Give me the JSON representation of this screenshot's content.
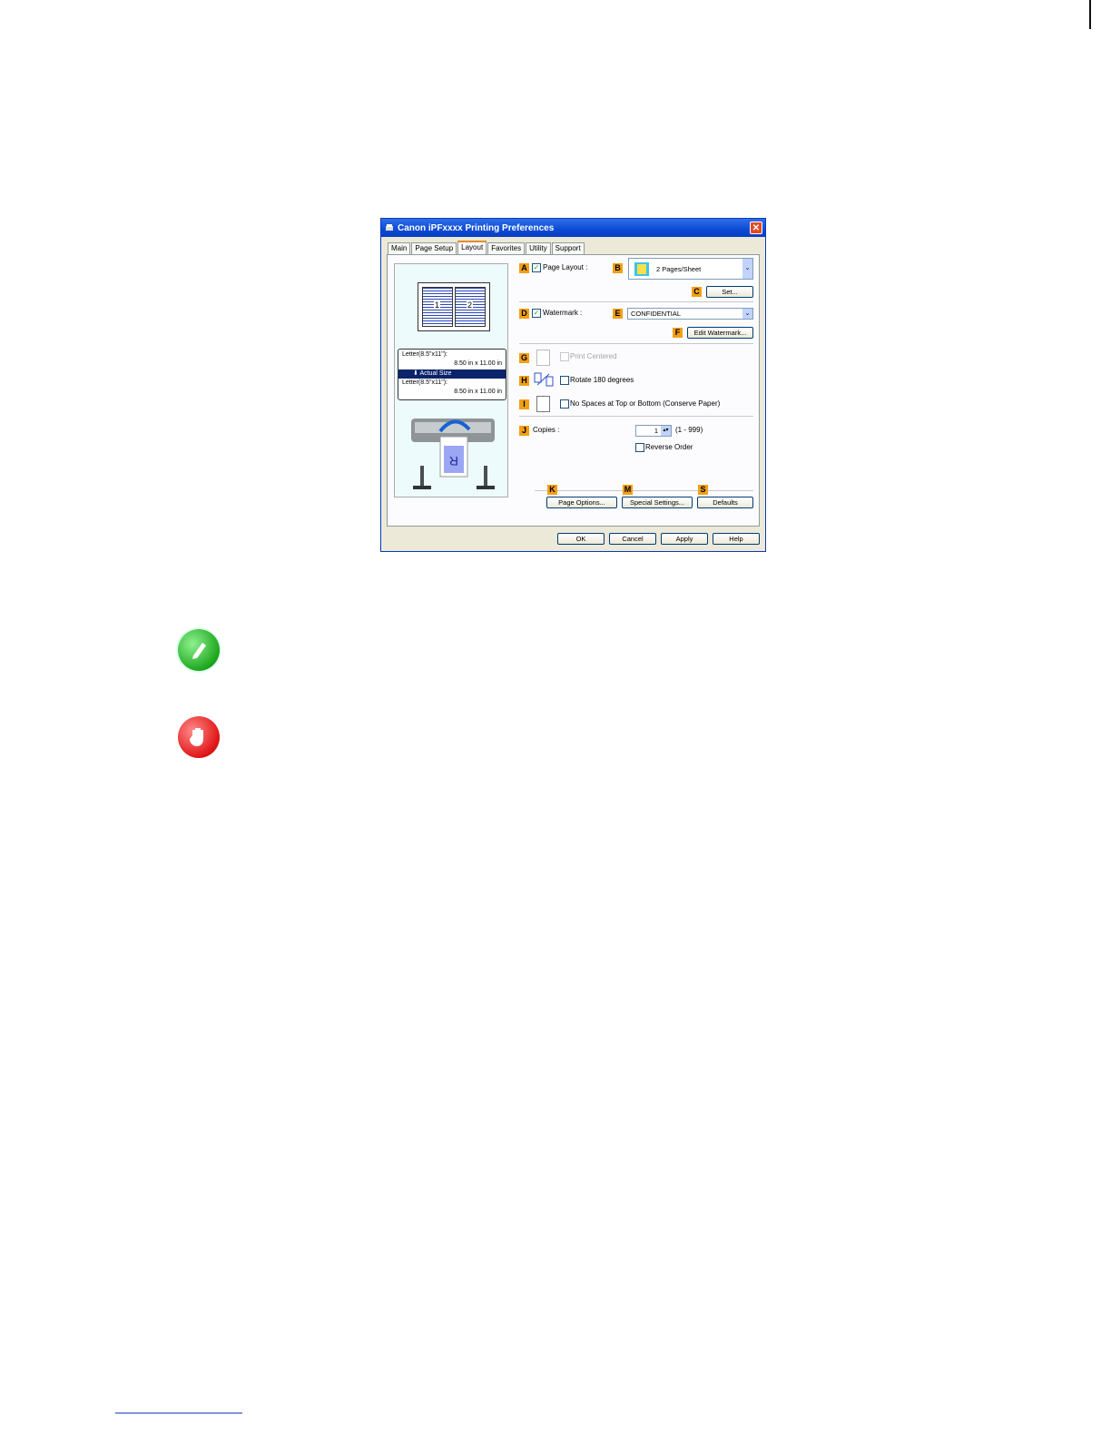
{
  "dialog": {
    "title": "Canon iPFxxxx Printing Preferences",
    "close_glyph": "✕",
    "tabs": [
      "Main",
      "Page Setup",
      "Layout",
      "Favorites",
      "Utility",
      "Support"
    ],
    "active_tab": "Layout",
    "preview": {
      "page_numbers": [
        "1",
        "2"
      ],
      "size_from": "Letter(8.5\"x11\"):",
      "size_from_dims": "8.50 in x 11.00 in",
      "scale_mode": "Actual Size",
      "size_to": "Letter(8.5\"x11\"):",
      "size_to_dims": "8.50 in x 11.00 in"
    },
    "badges": {
      "A": "A",
      "B": "B",
      "C": "C",
      "D": "D",
      "E": "E",
      "F": "F",
      "G": "G",
      "H": "H",
      "I": "I",
      "J": "J",
      "K": "K",
      "M": "M",
      "S": "S"
    },
    "page_layout": {
      "label": "Page Layout :",
      "checked": true,
      "value": "2 Pages/Sheet",
      "set_button": "Set..."
    },
    "watermark": {
      "label": "Watermark :",
      "checked": true,
      "value": "CONFIDENTIAL",
      "edit_button": "Edit Watermark..."
    },
    "print_centered": {
      "label": "Print Centered",
      "checked": false,
      "enabled": false
    },
    "rotate": {
      "label": "Rotate 180 degrees",
      "checked": false
    },
    "no_spaces": {
      "label": "No Spaces at Top or Bottom (Conserve Paper)",
      "checked": false
    },
    "copies": {
      "label": "Copies :",
      "value": "1",
      "range": "(1 - 999)",
      "reverse_order_label": "Reverse Order",
      "reverse_checked": false
    },
    "bottom_buttons": {
      "page_options": "Page Options...",
      "special_settings": "Special Settings...",
      "defaults": "Defaults"
    },
    "footer_buttons": {
      "ok": "OK",
      "cancel": "Cancel",
      "apply": "Apply",
      "help": "Help"
    },
    "checkmark_glyph": "✓",
    "dropdown_glyph": "⌄",
    "arrow_down_glyph": "⬇"
  },
  "icons": {
    "note": "pencil-icon",
    "important": "stop-hand-icon"
  },
  "colors": {
    "badge": "#f29f16",
    "titlebar": "#0b4ad4",
    "note": "#1fa81f",
    "important": "#e01515"
  }
}
